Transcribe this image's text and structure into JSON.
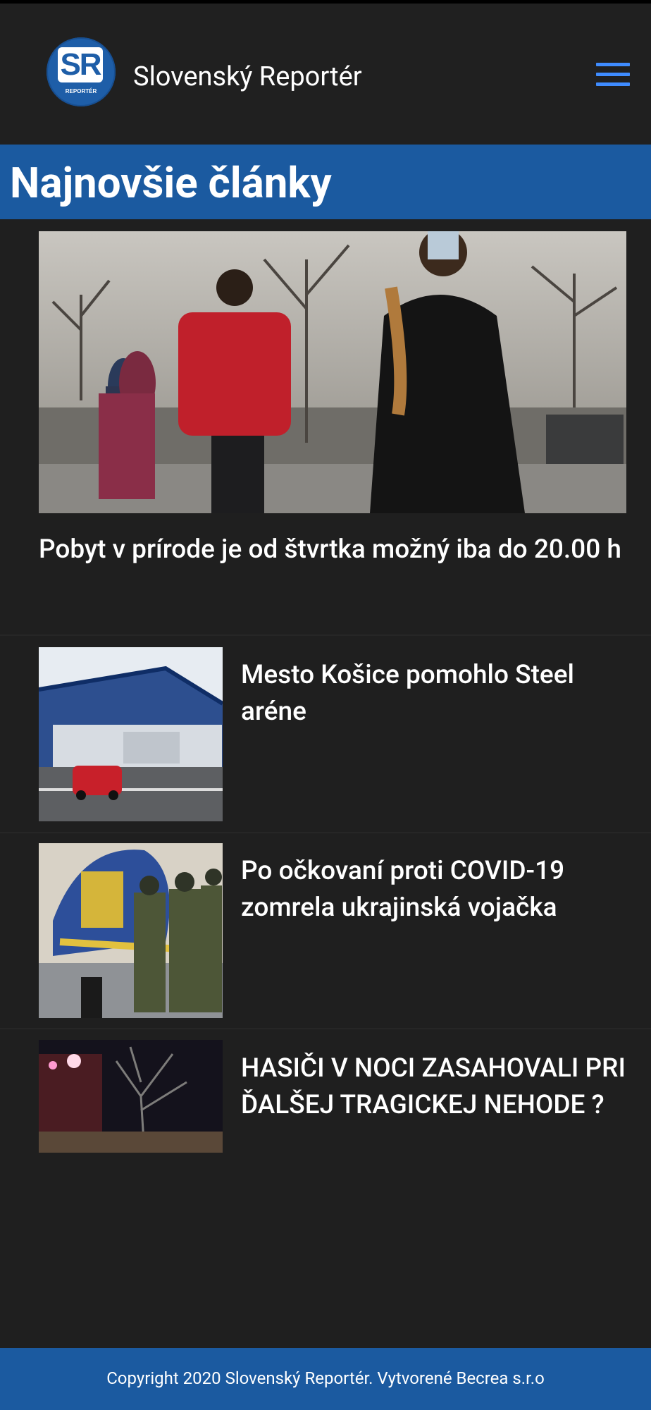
{
  "header": {
    "logo_text": "SR",
    "logo_subtext": "REPORTÉR",
    "site_title": "Slovenský Reportér",
    "menu_icon": "hamburger-menu-icon"
  },
  "section": {
    "title": "Najnovšie články"
  },
  "articles": [
    {
      "title": "Pobyt v prírode je od štvrtka možný iba do 20.00 h"
    },
    {
      "title": "Mesto Košice pomohlo Steel aréne"
    },
    {
      "title": "Po očkovaní proti COVID-19 zomrela ukrajinská vojačka"
    },
    {
      "title": "HASIČI V NOCI ZASAHOVALI PRI ĎALŠEJ TRAGICKEJ NEHODE ?"
    }
  ],
  "footer": {
    "copyright": "Copyright 2020 Slovenský Reportér. Vytvorené Becrea s.r.o"
  },
  "colors": {
    "accent": "#1b5aa0",
    "background": "#1f1f1f",
    "menu": "#3f8cff"
  }
}
